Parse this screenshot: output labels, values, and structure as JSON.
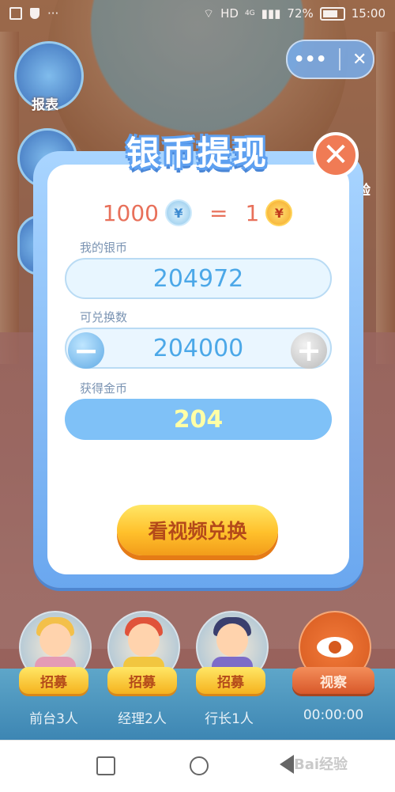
{
  "status_bar": {
    "network": "HD",
    "network_sup": "4G",
    "battery": "72%",
    "time": "15:00",
    "more": "···"
  },
  "top_capsule": {
    "more_label": "•••",
    "close_label": "✕"
  },
  "side_menu": {
    "report_label": "报表",
    "right_partial_label": "验"
  },
  "dialog": {
    "title": "银币提现",
    "close_symbol": "✕",
    "rate": {
      "silver_amount": "1000",
      "equals": "=",
      "gold_amount": "1",
      "coin_symbol": "¥"
    },
    "my_silver_label": "我的银币",
    "my_silver_value": "204972",
    "exchangeable_label": "可兑换数",
    "exchangeable_value": "204000",
    "minus_symbol": "−",
    "plus_symbol": "+",
    "gold_obtained_label": "获得金币",
    "gold_obtained_value": "204",
    "watch_button": "看视频兑换"
  },
  "bottom": {
    "recruits": [
      {
        "button": "招募",
        "label": "前台3人"
      },
      {
        "button": "招募",
        "label": "经理2人"
      },
      {
        "button": "招募",
        "label": "行长1人"
      }
    ],
    "observe_button": "视察",
    "timer": "00:00:00"
  },
  "watermark": "Bai经验",
  "colors": {
    "dialog_border": "#6aa7ef",
    "accent_orange": "#e8705a",
    "value_blue": "#4ca8e8",
    "gold_button": "#ffc02b"
  }
}
